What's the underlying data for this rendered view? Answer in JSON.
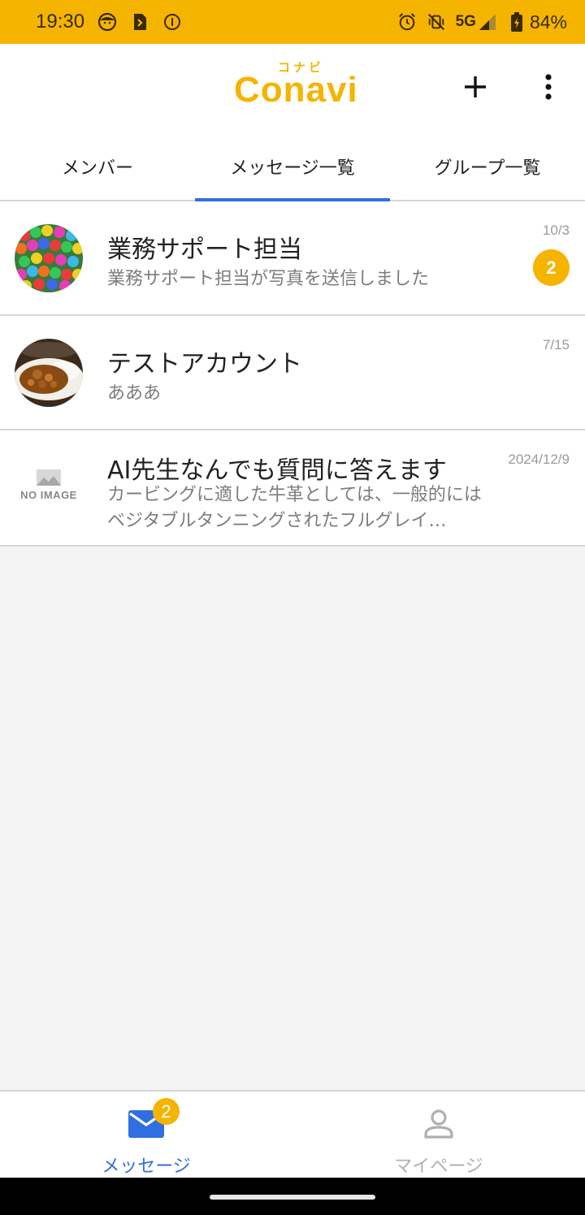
{
  "status_bar": {
    "time": "19:30",
    "network": "5G",
    "battery": "84%",
    "icons": [
      "face-icon",
      "sim-icon",
      "info-icon",
      "alarm-icon",
      "mute-vibrate-icon",
      "signal-icon",
      "battery-icon"
    ]
  },
  "header": {
    "logo_text": "Conavi",
    "logo_kana": "コナビ",
    "add_icon": "plus-icon",
    "menu_icon": "more-vert-icon"
  },
  "tabs": [
    {
      "label": "メンバー",
      "active": false
    },
    {
      "label": "メッセージ一覧",
      "active": true
    },
    {
      "label": "グループ一覧",
      "active": false
    }
  ],
  "messages": [
    {
      "title": "業務サポート担当",
      "preview": "業務サポート担当が写真を送信しました",
      "date": "10/3",
      "unread": "2",
      "avatar": "colorful-beads-photo"
    },
    {
      "title": "テストアカウント",
      "preview": "あああ",
      "date": "7/15",
      "avatar": "curry-rice-photo"
    },
    {
      "title": "AI先生なんでも質問に答えます",
      "preview": "カービングに適した牛革としては、一般的にはベジタブルタンニングされたフルグレイ…",
      "date": "2024/12/9",
      "avatar_placeholder": "NO IMAGE"
    }
  ],
  "bottom_nav": {
    "messages_label": "メッセージ",
    "messages_badge": "2",
    "mypage_label": "マイページ",
    "active_color": "#2f6fe0",
    "accent_color": "#f5b400"
  }
}
